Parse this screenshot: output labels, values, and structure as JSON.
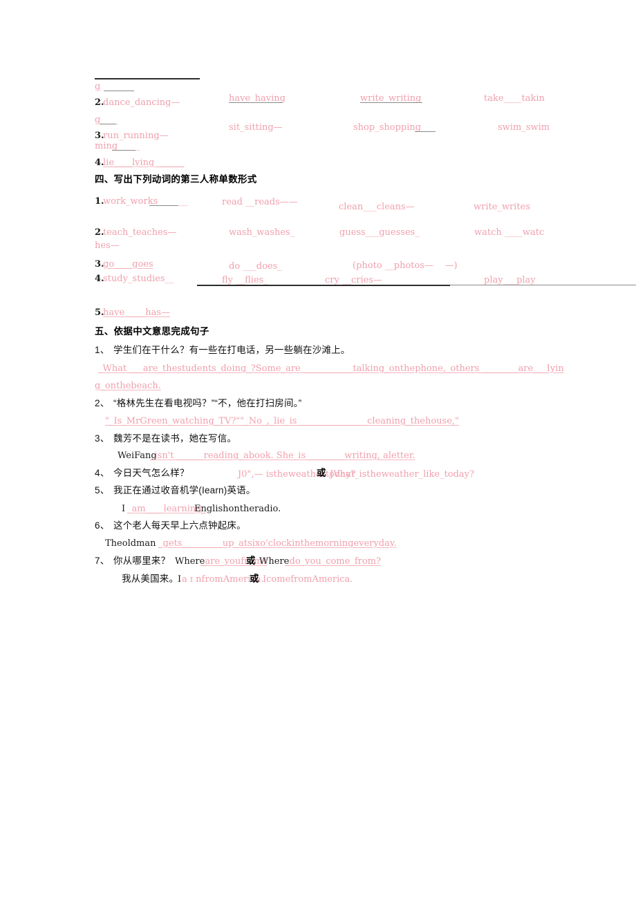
{
  "document": {
    "type": "worksheet",
    "language": "zh-CN + en",
    "answer_color": "#f0a0ad",
    "text_color": "#1a1a1a"
  },
  "top_rule": {
    "label": "horizontal-rule"
  },
  "section_three_tail": {
    "rows": [
      {
        "lead": "g",
        "lead_blank": "________"
      },
      {
        "num": "2.",
        "word": "dance_dancing—",
        "col2": "have_having",
        "col3": "write_writing",
        "col4": "take____takin"
      },
      {
        "cont": "g____"
      },
      {
        "num": "3.",
        "word": "run_running—",
        "col2": "sit_sitting—",
        "col3": "shop_shopping",
        "col4": "swim_swim"
      },
      {
        "cont": "ming_____"
      },
      {
        "num": "4.",
        "word": "lie____lying ______"
      }
    ]
  },
  "section_four": {
    "heading": "四、写出下列动词的第三人称单数形式",
    "rows": [
      {
        "num": "1.",
        "c1": "work_works ______",
        "c2": "read __reads——",
        "c3": "clean___cleans—",
        "c4": "write_writes"
      },
      {
        "num": "2.",
        "c1": "teach_teaches—",
        "c2": "wash_washes_",
        "c3": "guess___guesses_",
        "c4": "watch ____watc",
        "cont": "hes—"
      },
      {
        "num": "3.",
        "c1": "go____goes",
        "c2": "do ___does_",
        "c3": "(photo __photos—    —)",
        "c4": ""
      },
      {
        "num": "4.",
        "c1": "study_studies__",
        "c2": "fly __flies_",
        "c3": "cry __cries—",
        "c4": "play___play"
      },
      {
        "num": "5.",
        "c1": "have ____has—",
        "c2": "",
        "c3": "",
        "c4": ""
      }
    ]
  },
  "section_five": {
    "heading": "五、依据中文意思完成句子",
    "items": [
      {
        "num": "1、",
        "prompt_cn": "学生们在干什么？有一些在打电话，另一些躺在沙滩上。",
        "answer_line1": "_What ___are_thestudents_doing_?Some_are ___________talking_onthephone,_others ________are___Iyin",
        "answer_line2": "g_onthebeach."
      },
      {
        "num": "2、",
        "prompt_cn": "“格林先生在看电视吗？”“不，他在打扫房间。”",
        "answer_line1": "\"_Is_MrGreen_watching_TV?\"\"_No_,_lie_is _______________cleaning_thehouse,\""
      },
      {
        "num": "3、",
        "prompt_cn": "魏芳不是在读书，她在写信。",
        "answer_line1_black": "WeiFang",
        "answer_line1": "_isn't ______reading_abook. She_is ________writing, aletter."
      },
      {
        "num": "4、",
        "prompt_cn": "今日天气怎么样？",
        "answer_a": "J0\",— istheweathertoday?",
        "or_word": "或",
        "answer_b": "JVhat_istheweather_like_today?"
      },
      {
        "num": "5、",
        "prompt_cn": "我正在通过收音机学(Iearn)英语。",
        "answer_pre": "I",
        "answer_mid": "_am____learning_",
        "answer_post": "Englishontheradio."
      },
      {
        "num": "6、",
        "prompt_cn": "这个老人每天早上六点钟起床。",
        "answer_pre": "Theoldman",
        "answer_line": "_gets_________up_atsixo'clockinthemorningeveryday."
      },
      {
        "num": "7、",
        "prompt_cn": "你从哪里来？",
        "q_black1": "Where",
        "q_pink1": "_are_youfrom?",
        "or_word": "或",
        "q_black2": "Where",
        "q_pink2": "_do_you_come_from?",
        "sub_cn": "我从美国来。",
        "sub_black1": "I",
        "sub_pink1": "a ɪ nfromAmerica.",
        "sub_or": "或",
        "sub_pink2": "IcomefromAmerica."
      }
    ]
  }
}
